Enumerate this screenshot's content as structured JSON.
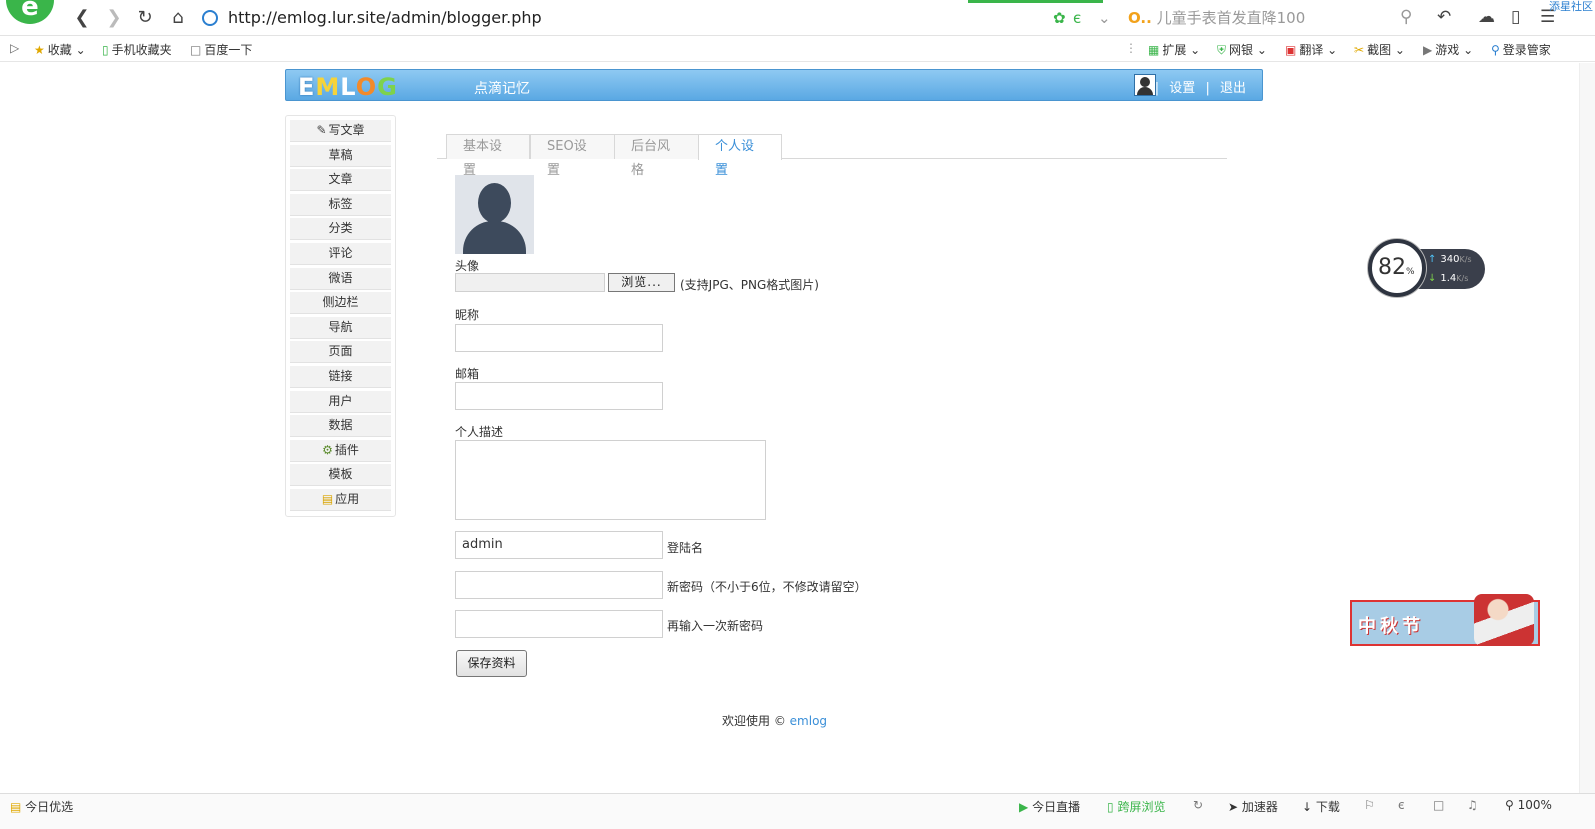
{
  "browser": {
    "url": "http://emlog.lur.site/admin/blogger.php",
    "search_placeholder": "儿童手表首发直降100",
    "search_prefix": "O..",
    "corner_text": "添星社区"
  },
  "bookmarks": {
    "left": [
      "收藏",
      "手机收藏夹",
      "百度一下"
    ],
    "right": [
      "扩展",
      "网银",
      "翻译",
      "截图",
      "游戏",
      "登录管家"
    ]
  },
  "header": {
    "logo_letters": [
      "E",
      "M",
      "L",
      "O",
      "G"
    ],
    "site_name": "点滴记忆",
    "link_settings": "设置",
    "link_logout": "退出",
    "separator": "|"
  },
  "sidebar": {
    "items": [
      "写文章",
      "草稿",
      "文章",
      "标签",
      "分类",
      "评论",
      "微语",
      "侧边栏",
      "导航",
      "页面",
      "链接",
      "用户",
      "数据",
      "插件",
      "模板",
      "应用"
    ]
  },
  "tabs": [
    "基本设置",
    "SEO设置",
    "后台风格",
    "个人设置"
  ],
  "form": {
    "avatar_label": "头像",
    "browse_button": "浏览...",
    "avatar_hint": "(支持JPG、PNG格式图片)",
    "nickname_label": "昵称",
    "nickname_value": "",
    "email_label": "邮箱",
    "email_value": "",
    "description_label": "个人描述",
    "login_value": "admin",
    "login_label": "登陆名",
    "new_password_label": "新密码（不小于6位，不修改请留空）",
    "repeat_password_label": "再输入一次新密码",
    "save_button": "保存资料"
  },
  "footer": {
    "text": "欢迎使用 ©",
    "link": "emlog"
  },
  "speed_widget": {
    "percent": "82",
    "percent_unit": "%",
    "up_value": "340",
    "down_value": "1.4",
    "unit": "K/s"
  },
  "ad": {
    "text": "中秋节"
  },
  "status_bar": {
    "left": "今日优选",
    "right": [
      "今日直播",
      "跨屏浏览",
      "加速器",
      "下载",
      "100%"
    ]
  },
  "colors": {
    "header_top": "#8ec9f2",
    "header_bottom": "#5aa8e3",
    "active_tab": "#3a8fd8",
    "link": "#3a8fd8",
    "browser_green": "#3ab54a"
  }
}
